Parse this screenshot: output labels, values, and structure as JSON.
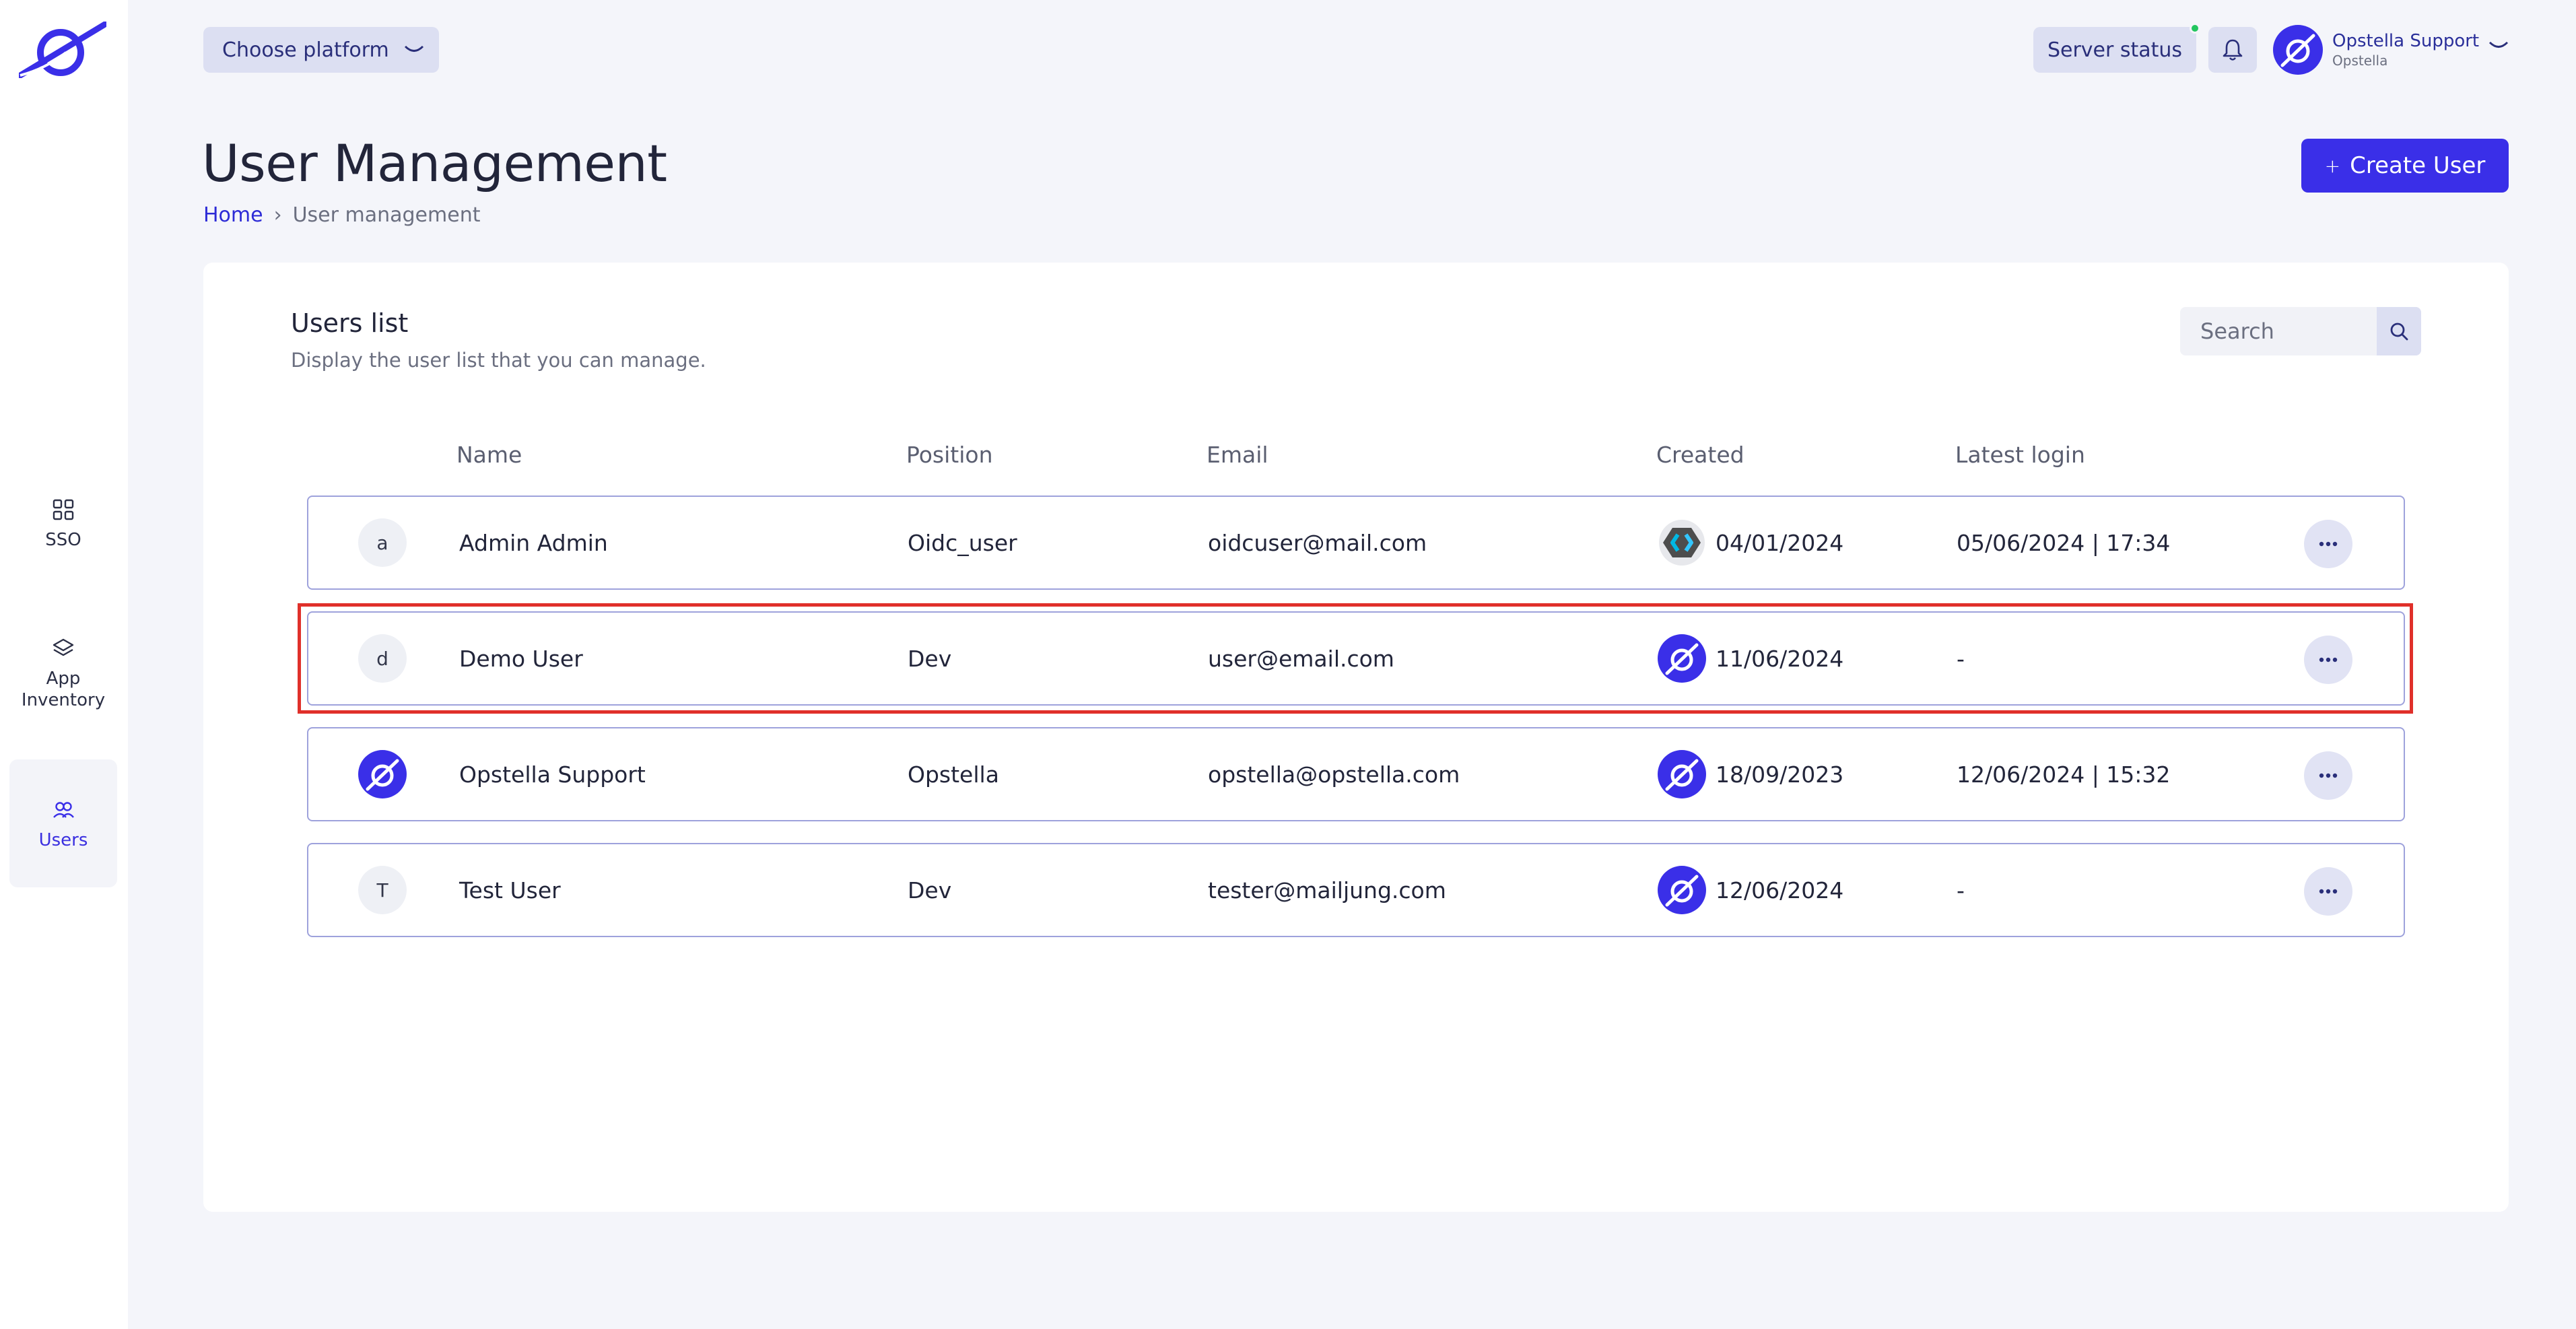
{
  "app": {
    "logo_icon": "opstella-planet-logo-icon",
    "accent": "#3a2fe8",
    "status_online_color": "#22c55e"
  },
  "sidebar": {
    "items": [
      {
        "label": "SSO",
        "icon": "grid-icon",
        "active": false
      },
      {
        "label": "App Inventory",
        "label_line1": "App",
        "label_line2": "Inventory",
        "icon": "layers-icon",
        "active": false
      },
      {
        "label": "Users",
        "icon": "users-icon",
        "active": true
      }
    ]
  },
  "topbar": {
    "platform_label": "Choose platform",
    "server_status_label": "Server status",
    "user_name": "Opstella Support",
    "user_org": "Opstella"
  },
  "header": {
    "title": "User Management",
    "breadcrumb": [
      "Home",
      "User management"
    ],
    "create_label": "Create User"
  },
  "users_card": {
    "title": "Users list",
    "subtitle": "Display the user list that you can manage.",
    "search_placeholder": "Search",
    "columns": [
      "Name",
      "Position",
      "Email",
      "Created",
      "Latest login"
    ],
    "rows": [
      {
        "initial": "a",
        "name": "Admin Admin",
        "position": "Oidc_user",
        "email": "oidcuser@mail.com",
        "created_icon": "keycloak-icon",
        "created": "04/01/2024",
        "latest_login": "05/06/2024 | 17:34",
        "highlighted": false
      },
      {
        "initial": "d",
        "name": "Demo User",
        "position": "Dev",
        "email": "user@email.com",
        "created_icon": "opstella-logo-icon",
        "created": "11/06/2024",
        "latest_login": "-",
        "highlighted": true
      },
      {
        "initial": "",
        "avatar_icon": "opstella-logo-icon",
        "name": "Opstella Support",
        "position": "Opstella",
        "email": "opstella@opstella.com",
        "created_icon": "opstella-logo-icon",
        "created": "18/09/2023",
        "latest_login": "12/06/2024 | 15:32",
        "highlighted": false
      },
      {
        "initial": "T",
        "name": "Test User",
        "position": "Dev",
        "email": "tester@mailjung.com",
        "created_icon": "opstella-logo-icon",
        "created": "12/06/2024",
        "latest_login": "-",
        "highlighted": false
      }
    ]
  }
}
